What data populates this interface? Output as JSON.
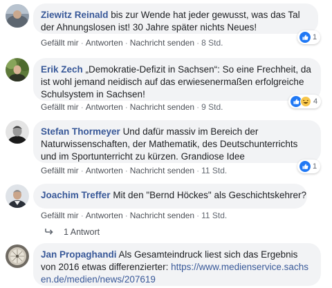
{
  "comments": [
    {
      "name": "Ziewitz Reinald",
      "text": "bis zur Wende hat jeder gewusst, was das Tal der Ahnungslosen ist! 30 Jahre später nichts Neues!",
      "like": "Gefällt mir",
      "reply": "Antworten",
      "message": "Nachricht senden",
      "time": "8 Std.",
      "reaction_count": "1"
    },
    {
      "name": "Erik Zech",
      "text": "„Demokratie-Defizit in Sachsen“: So eine Frechheit, da ist wohl jemand neidisch auf das erwiesenermaßen erfolgreiche Schulsystem in Sachsen!",
      "like": "Gefällt mir",
      "reply": "Antworten",
      "message": "Nachricht senden",
      "time": "9 Std.",
      "reaction_count": "4"
    },
    {
      "name": "Stefan Thormeyer",
      "text": "Und dafür massiv im Bereich der Naturwissenschaften, der Mathematik, des Deutschunterrichts und im Sportunterricht zu kürzen. Grandiose Idee",
      "like": "Gefällt mir",
      "reply": "Antworten",
      "message": "Nachricht senden",
      "time": "11 Std.",
      "reaction_count": "1"
    },
    {
      "name": "Joachim Treffer",
      "text": "Mit den \"Bernd Höckes\" als Geschichtskehrer?",
      "like": "Gefällt mir",
      "reply": "Antworten",
      "message": "Nachricht senden",
      "time": "11 Std."
    },
    {
      "name": "Jan Propaghandi",
      "text": "Als Gesamteindruck liest sich das Ergebnis von 2016 etwas differenzierter: ",
      "link": "https://www.medienservice.sachsen.de/medien/news/207619"
    }
  ],
  "replies_label": "1 Antwort",
  "colors": {
    "name": "#385898",
    "bubble": "#f2f3f5",
    "meta": "#616770",
    "like_icon": "#2078f4",
    "haha_icon": "#f7c64b"
  },
  "icons": {
    "reaction_like": "thumbs-up-icon",
    "reaction_haha": "laughing-face-icon",
    "reply_arrow": "reply-arrow-icon"
  }
}
